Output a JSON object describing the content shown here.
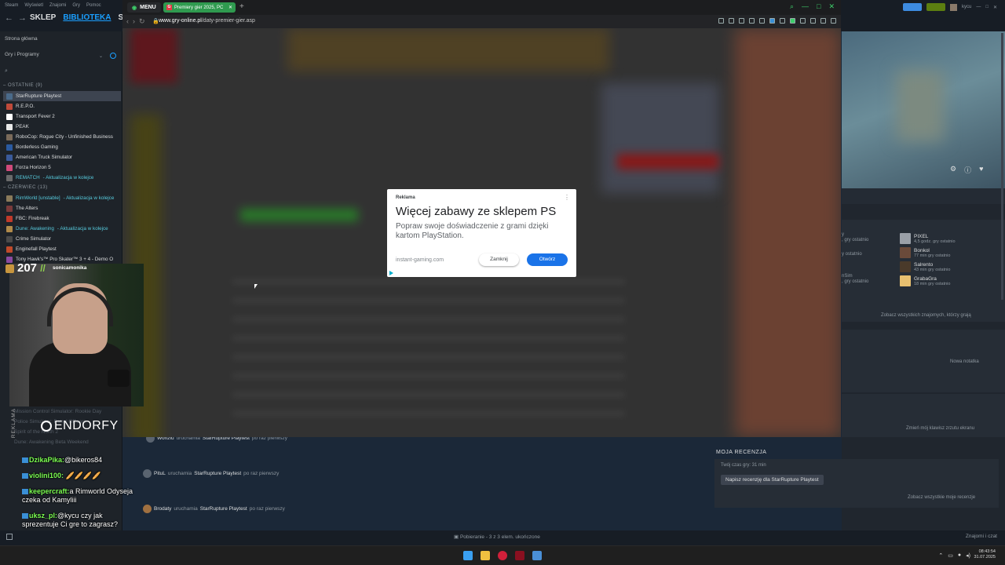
{
  "steam": {
    "menu": [
      "Steam",
      "Wyświetl",
      "Znajomi",
      "Gry",
      "Pomoc"
    ],
    "tabs": [
      "SKLEP",
      "BIBLIOTEKA",
      "SPO"
    ],
    "user": "kycu",
    "home": "Strona główna",
    "filter": "Gry i Programy",
    "section_recent": "OSTATNIE",
    "section_recent_count": "(9)",
    "recent_games": [
      {
        "name": "StarRupture Playtest",
        "color": "#4a6a8a"
      },
      {
        "name": "R.E.P.O.",
        "color": "#c04a3a"
      },
      {
        "name": "Transport Fever 2",
        "color": "#ffffff"
      },
      {
        "name": "PEAK",
        "color": "#e8e8e8"
      },
      {
        "name": "RoboCop: Rogue City - Unfinished Business",
        "color": "#7a6a5a"
      },
      {
        "name": "Borderless Gaming",
        "color": "#2a5aa0"
      },
      {
        "name": "American Truck Simulator",
        "color": "#3a5a9a"
      },
      {
        "name": "Forza Horizon 5",
        "color": "#d04a7a"
      },
      {
        "name": "REMATCH",
        "color": "#6a6a6a",
        "status": " - Aktualizacja w kolejce"
      }
    ],
    "section_june": "CZERWIEC",
    "section_june_count": "(13)",
    "june_games": [
      {
        "name": "RimWorld [unstable]",
        "color": "#8a7a5a",
        "status": " - Aktualizacja w kolejce"
      },
      {
        "name": "The Alters",
        "color": "#7a3a3a"
      },
      {
        "name": "FBC: Firebreak",
        "color": "#c03a2a"
      },
      {
        "name": "Dune: Awakening",
        "color": "#b08a4a",
        "status": " - Aktualizacja w kolejce"
      },
      {
        "name": "Crime Simulator",
        "color": "#4a4a4a"
      },
      {
        "name": "Enginefall Playtest",
        "color": "#c04a2a"
      },
      {
        "name": "Tony Hawk's™ Pro Skater™ 3 + 4 - Demo O",
        "color": "#8a4aa0"
      }
    ],
    "lower_games": [
      "Mission Control Simulator: Rookie Day",
      "Police Simulator: Patrol Officers",
      "Spirit of the North 2",
      "Dune: Awakening Beta Weekend"
    ]
  },
  "browser": {
    "menu_label": "MENU",
    "tab_title": "Premiery gier 2025, PC",
    "url_domain": "www.gry-online.pl",
    "url_path": "/daty-premier-gier.asp"
  },
  "ad": {
    "label": "Reklama",
    "title": "Więcej zabawy ze sklepem PS",
    "description": "Popraw swoje doświadczenie z grami dzięki kartom PlayStation.",
    "domain": "instant-gaming.com",
    "close_label": "Zamknij",
    "open_label": "Otwórz"
  },
  "right_panel": {
    "friends": [
      {
        "name": "PIXEL",
        "sub": "4,5 godz. gry ostatnio",
        "color": "#9aa0a8"
      },
      {
        "name": "Bonkol",
        "sub": "77 min gry ostatnio",
        "color": "#6a4a3a"
      },
      {
        "name": "Salrento",
        "sub": "43 min gry ostatnio",
        "color": "#4a3a2a"
      },
      {
        "name": "GrabaGra",
        "sub": "18 min gry ostatnio",
        "color": "#e8c070"
      }
    ],
    "left_cut": [
      "y",
      ", gry ostatnio",
      "y ostatnio",
      "nSim",
      ", gry ostatnio"
    ],
    "see_all_friends": "Zobacz wszystkich znajomych, którzy grają",
    "new_note": "Nowa notatka",
    "change_screenshot_key": "Zmień mój klawisz zrzutu ekranu"
  },
  "review": {
    "title": "MOJA RECENZJA",
    "playtime": "Twój czas gry: 31 min",
    "write": "Napisz recenzję dla StarRupture Playtest",
    "see_all": "Zobacz wszystkie moje recenzje"
  },
  "activity": [
    {
      "user": "Wonziu",
      "action": "uruchamia",
      "game": "StarRupture Playtest",
      "suffix": "po raz pierwszy"
    },
    {
      "user": "PituL",
      "action": "uruchamia",
      "game": "StarRupture Playtest",
      "suffix": "po raz pierwszy"
    },
    {
      "user": "Brodaty",
      "action": "uruchamia",
      "game": "StarRupture Playtest",
      "suffix": "po raz pierwszy"
    }
  ],
  "stream": {
    "count": "207",
    "slashes": "//",
    "username": "sonicamonika",
    "ad_vertical": "REKLAMA",
    "sponsor": "ENDORFY"
  },
  "chat": [
    {
      "user": "DzikaPika:",
      "text": "@bikeros84"
    },
    {
      "user": "violini100:",
      "text": ""
    },
    {
      "user": "keepercraft:",
      "text": "a Rimworld Odyseja czeka od Kamyliii"
    },
    {
      "user": "uksz_pl:",
      "text": "@kycu czy jak sprezentuje Ci gre to zagrasz?"
    }
  ],
  "status": {
    "download": "Pobieranie - 3 z 3 elem. ukończone",
    "friends_chat": "Znajomi i czat"
  },
  "taskbar": {
    "time": "08:43:54",
    "date": "31.07.2025"
  }
}
